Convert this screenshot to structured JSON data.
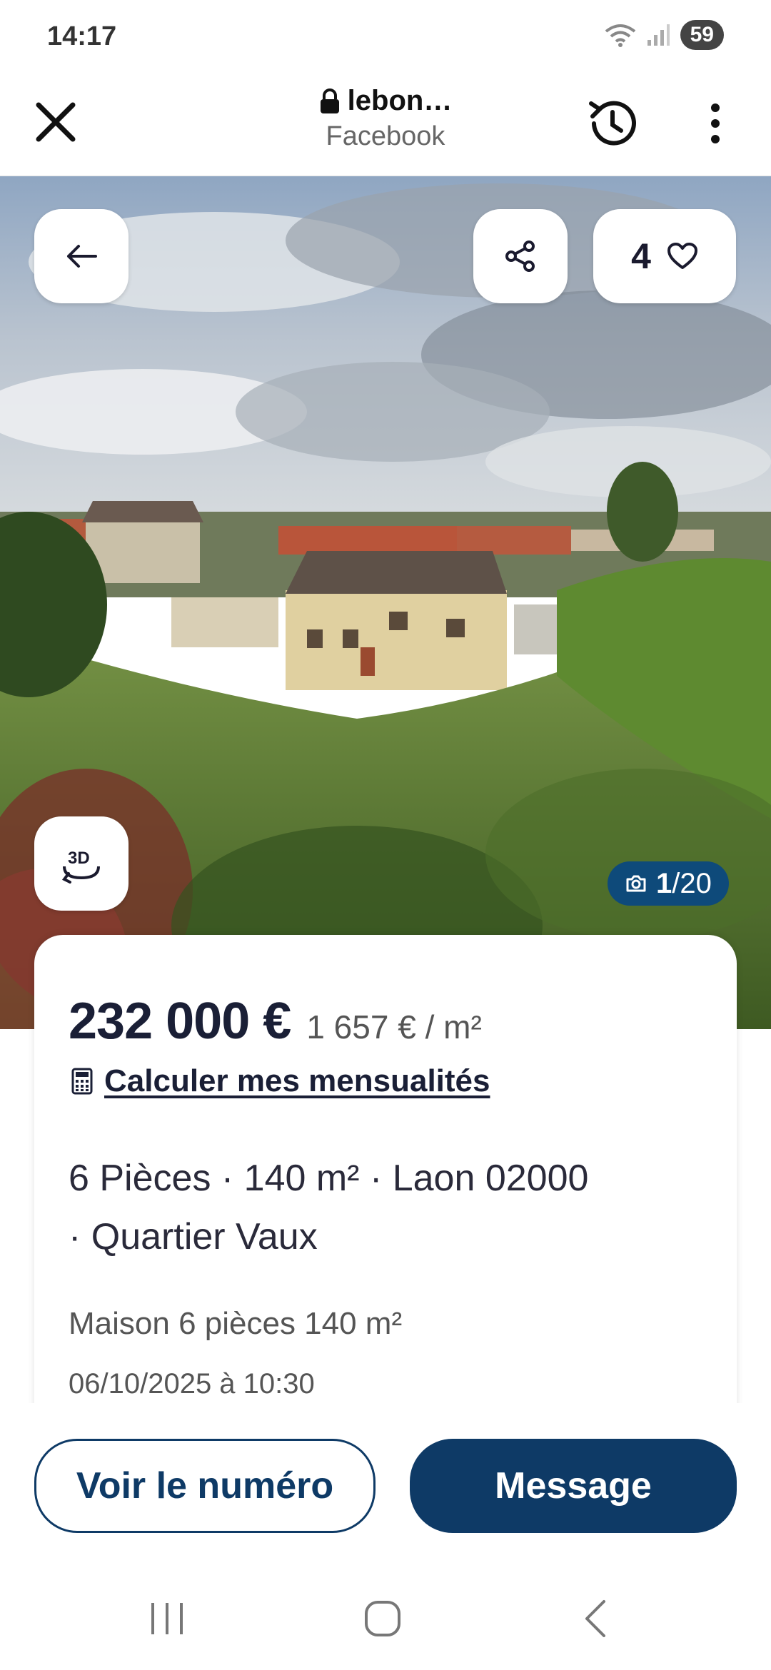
{
  "status_bar": {
    "time": "14:17",
    "battery": "59"
  },
  "browser": {
    "url": "lebon…",
    "source": "Facebook"
  },
  "icons": {
    "close": "close-icon",
    "lock": "lock-icon",
    "history": "history-icon",
    "more": "more-vert-icon",
    "back": "arrow-left-icon",
    "share": "share-icon",
    "heart": "heart-icon",
    "view3d": "3d-rotate-icon",
    "camera": "camera-icon",
    "calculator": "calculator-icon"
  },
  "listing": {
    "favorites": "4",
    "photo_current": "1",
    "photo_total": "/20",
    "price": "232 000 €",
    "price_per_m2": "1 657 € / m²",
    "calc_link": "Calculer mes mensualités",
    "details_line1": "6 Pièces · 140 m² · Laon 02000",
    "details_line2": "· Quartier Vaux",
    "subtitle": "Maison 6 pièces 140 m²",
    "date": "06/10/2025 à 10:30"
  },
  "actions": {
    "see_number": "Voir le numéro",
    "message": "Message"
  },
  "colors": {
    "brand": "#0e3a66",
    "counter_bg": "#0e4a7a"
  }
}
